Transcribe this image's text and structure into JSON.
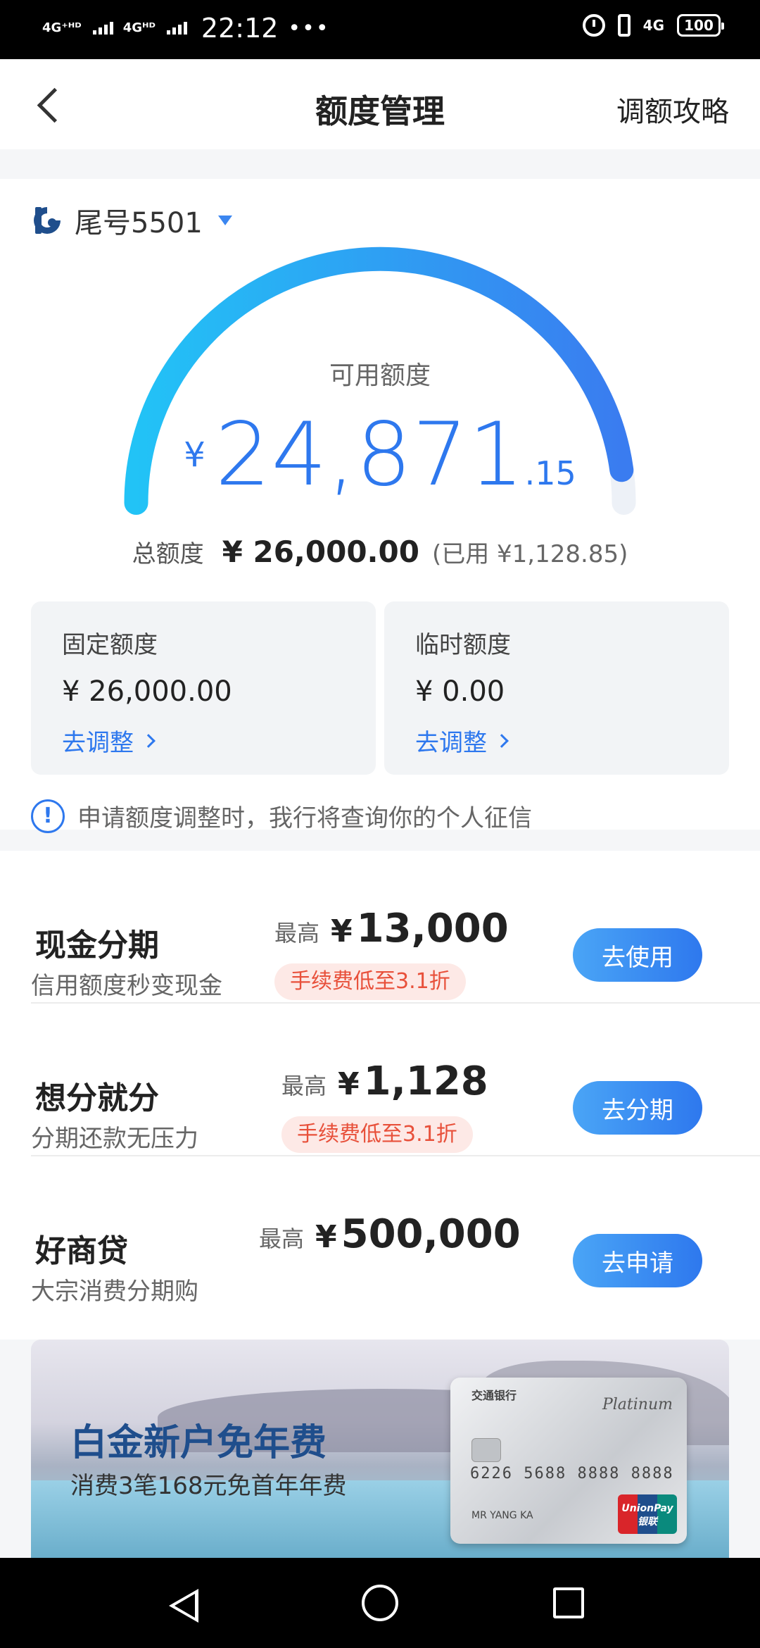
{
  "status_bar": {
    "signal1": "4G⁺ᴴᴰ",
    "signal2": "4Gᴴᴰ",
    "time": "22:12",
    "dots": "•••",
    "network": "4G",
    "battery": "100"
  },
  "header": {
    "title": "额度管理",
    "right_link": "调额攻略"
  },
  "account": {
    "label": "尾号5501"
  },
  "limit": {
    "available_label": "可用额度",
    "currency": "¥",
    "available_int": "24,871",
    "available_dec": ".15",
    "available_fraction": 0.957,
    "total_label": "总额度",
    "total_value": "¥ 26,000.00",
    "used_text": "(已用 ¥1,128.85)"
  },
  "sub_limits": {
    "fixed": {
      "label": "固定额度",
      "value": "¥ 26,000.00",
      "link": "去调整"
    },
    "temp": {
      "label": "临时额度",
      "value": "¥ 0.00",
      "link": "去调整"
    }
  },
  "notice": {
    "icon": "!",
    "text": "申请额度调整时，我行将查询你的个人征信"
  },
  "products": [
    {
      "name": "现金分期",
      "desc": "信用额度秒变现金",
      "max_label": "最高",
      "currency": "¥",
      "amount": "13,000",
      "tag": "手续费低至3.1折",
      "button": "去使用"
    },
    {
      "name": "想分就分",
      "desc": "分期还款无压力",
      "max_label": "最高",
      "currency": "¥",
      "amount": "1,128",
      "tag": "手续费低至3.1折",
      "button": "去分期"
    },
    {
      "name": "好商贷",
      "desc": "大宗消费分期购",
      "max_label": "最高",
      "currency": "¥",
      "amount": "500,000",
      "tag": "",
      "button": "去申请"
    }
  ],
  "banner": {
    "title": "白金新户免年费",
    "subtitle": "消费3笔168元免首年年费",
    "card_bank": "交通银行",
    "card_tier": "Platinum",
    "card_number": "6226 5688 8888 8888",
    "card_name": "MR YANG KA",
    "card_network": "UnionPay 银联"
  },
  "colors": {
    "accent": "#2e78ee",
    "gauge_start": "#22c3f6",
    "gauge_end": "#3a7cf0",
    "tag_bg": "#fde9e6",
    "tag_text": "#e8503a"
  }
}
